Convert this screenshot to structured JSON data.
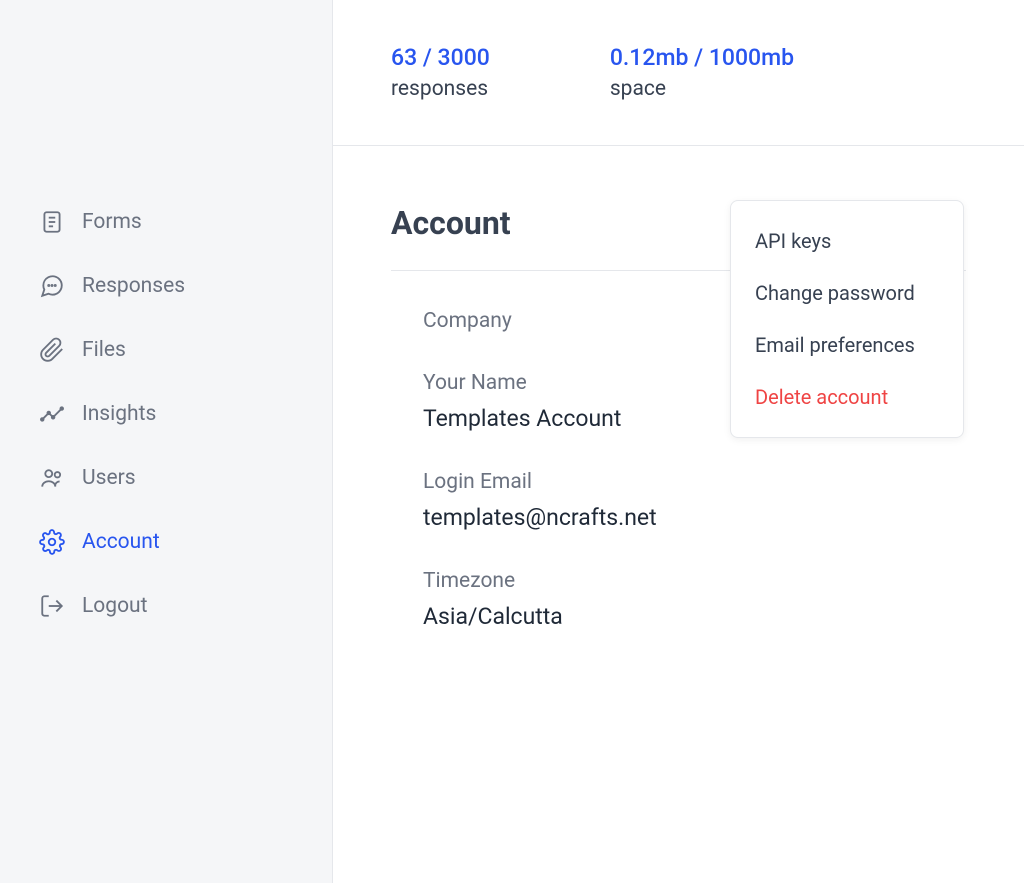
{
  "sidebar": {
    "items": [
      {
        "label": "Forms"
      },
      {
        "label": "Responses"
      },
      {
        "label": "Files"
      },
      {
        "label": "Insights"
      },
      {
        "label": "Users"
      },
      {
        "label": "Account"
      },
      {
        "label": "Logout"
      }
    ]
  },
  "stats": {
    "responses": {
      "value": "63 / 3000",
      "label": "responses"
    },
    "space": {
      "value": "0.12mb / 1000mb",
      "label": "space"
    }
  },
  "page": {
    "title": "Account"
  },
  "fields": {
    "company": {
      "label": "Company",
      "value": ""
    },
    "name": {
      "label": "Your Name",
      "value": "Templates Account"
    },
    "email": {
      "label": "Login Email",
      "value": "templates@ncrafts.net"
    },
    "timezone": {
      "label": "Timezone",
      "value": "Asia/Calcutta"
    }
  },
  "dropdown": {
    "items": [
      {
        "label": "API keys"
      },
      {
        "label": "Change password"
      },
      {
        "label": "Email preferences"
      },
      {
        "label": "Delete account"
      }
    ]
  }
}
